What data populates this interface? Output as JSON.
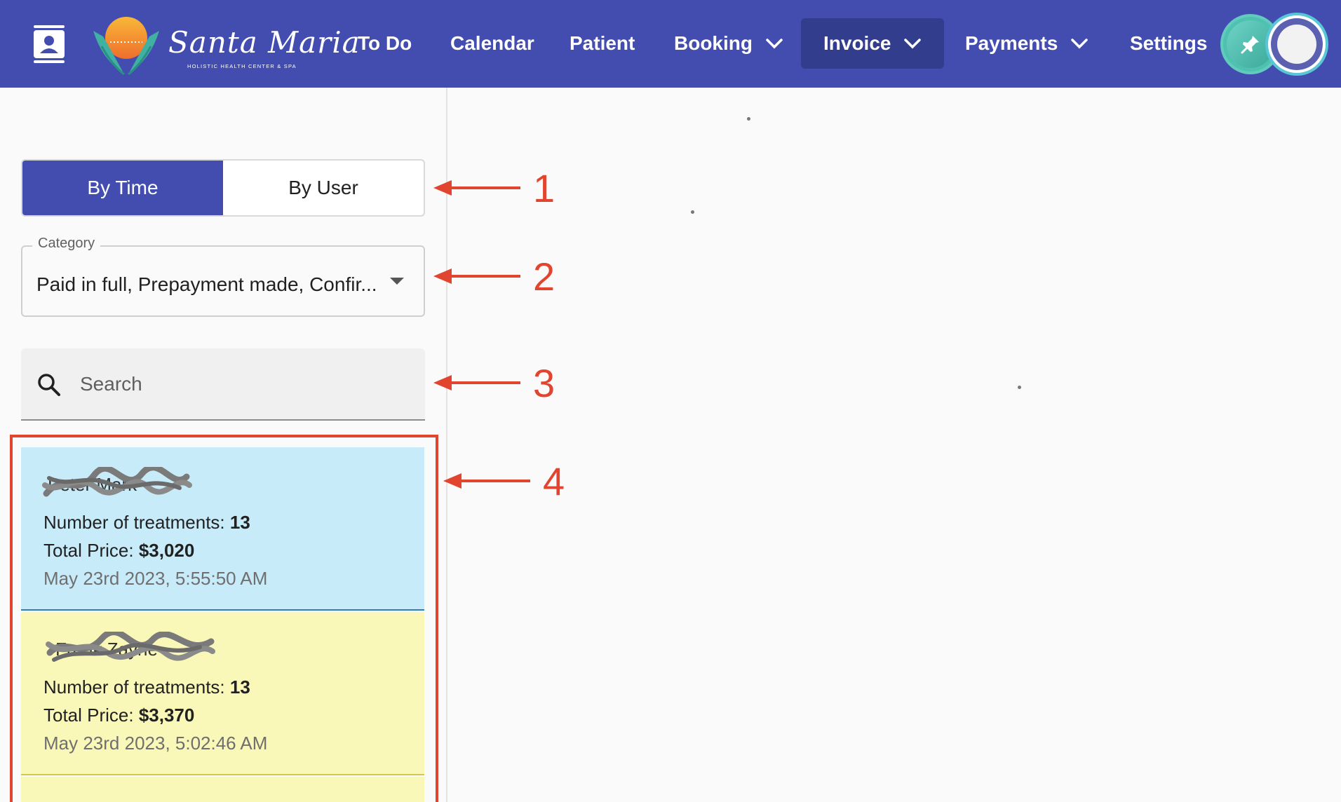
{
  "app": {
    "brand_name": "Santa Maria",
    "brand_tagline": "HOLISTIC HEALTH CENTER & SPA"
  },
  "navbar": {
    "items": [
      {
        "label": "To Do"
      },
      {
        "label": "Calendar"
      },
      {
        "label": "Patient"
      },
      {
        "label": "Booking",
        "has_dropdown": true
      },
      {
        "label": "Invoice",
        "has_dropdown": true,
        "active": true
      },
      {
        "label": "Payments",
        "has_dropdown": true
      },
      {
        "label": "Settings"
      }
    ],
    "icons": [
      "contacts-icon",
      "pin-icon",
      "avatar"
    ]
  },
  "filters": {
    "toggle": [
      "By Time",
      "By User"
    ],
    "active_toggle": "By Time",
    "category_label": "Category",
    "category_value": "Paid in full, Prepayment made, Confir...",
    "search_placeholder": "Search"
  },
  "invoices": [
    {
      "name_redacted": true,
      "treatments_label": "Number of treatments: ",
      "treatments": "13",
      "price_label": "Total Price: ",
      "price": "$3,020",
      "date": "May 23rd 2023, 5:55:50 AM",
      "color": "#c8ebfa"
    },
    {
      "name_redacted": true,
      "treatments_label": "Number of treatments: ",
      "treatments": "13",
      "price_label": "Total Price: ",
      "price": "$3,370",
      "date": "May 23rd 2023, 5:02:46 AM",
      "color": "#faf8b8"
    }
  ],
  "annotations": [
    "1",
    "2",
    "3",
    "4"
  ],
  "colors": {
    "primary": "#424daf",
    "primary_dark": "#323d8e",
    "annotation": "#e2452f",
    "accent_teal": "#4fc1b0"
  }
}
